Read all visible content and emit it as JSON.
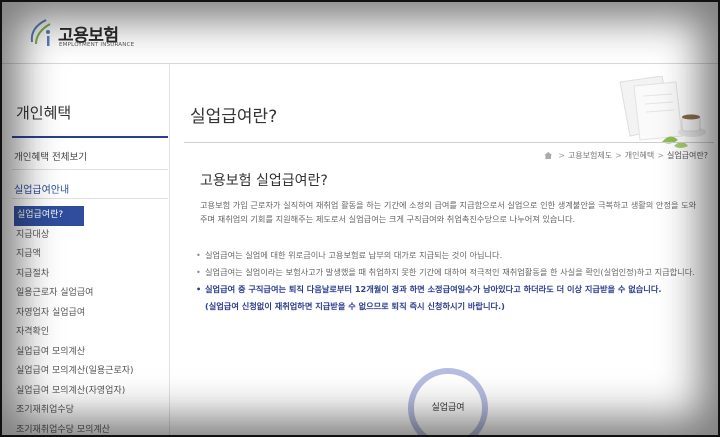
{
  "header": {
    "logo_kr": "고용보험",
    "logo_en": "EMPLOYMENT INSURANCE"
  },
  "sidebar": {
    "title": "개인혜택",
    "all_link": "개인혜택 전체보기",
    "section": "실업급여안내",
    "items": [
      {
        "label": "실업급여란?",
        "active": true
      },
      {
        "label": "지급대상"
      },
      {
        "label": "지급액"
      },
      {
        "label": "지급절차"
      },
      {
        "label": "일용근로자 실업급여"
      },
      {
        "label": "자영업자 실업급여"
      },
      {
        "label": "자격확인"
      },
      {
        "label": "실업급여 모의계산"
      },
      {
        "label": "실업급여 모의계산(일용근로자)"
      },
      {
        "label": "실업급여 모의계산(자영업자)"
      },
      {
        "label": "조기재취업수당"
      },
      {
        "label": "조기재취업수당 모의계산"
      }
    ]
  },
  "main": {
    "page_title": "실업급여란?",
    "breadcrumb": [
      "고용보험제도",
      "개인혜택",
      "실업급여란?"
    ],
    "heading": "고용보험 실업급여란?",
    "intro": "고용보험 가입 근로자가 실직하여 재취업 활동을 하는 기간에 소정의 급여를 지급함으로서 실업으로 인한 생계불안을 극복하고 생활의 안정을 도와주며 재취업의 기회를 지원해주는 제도로서 실업급여는 크게 구직급여와 취업촉진수당으로 나누어져 있습니다.",
    "bullets": [
      "실업급여는 실업에 대한 위로금이나 고용보험료 납부의 대가로 지급되는 것이 아닙니다.",
      "실업급여는 실업이라는 보험사고가 발생했을 때 취업하지 못한 기간에 대하여 적극적인 재취업활동을 한 사실을 확인(실업인정)하고 지급합니다."
    ],
    "emph_bullet": "실업급여 중 구직급여는 퇴직 다음날로부터 12개월이 경과 하면 소정급여일수가 남아있다고 하더라도 더 이상 지급받을 수 없습니다.",
    "emph_note": "(실업급여 신청없이 재취업하면 지급받을 수 없으므로 퇴직 즉시 신청하시기 바랍니다.)",
    "circle_label": "실업급여"
  },
  "colors": {
    "accent": "#2f4d9c",
    "circle_ring": "#b7bde0"
  }
}
